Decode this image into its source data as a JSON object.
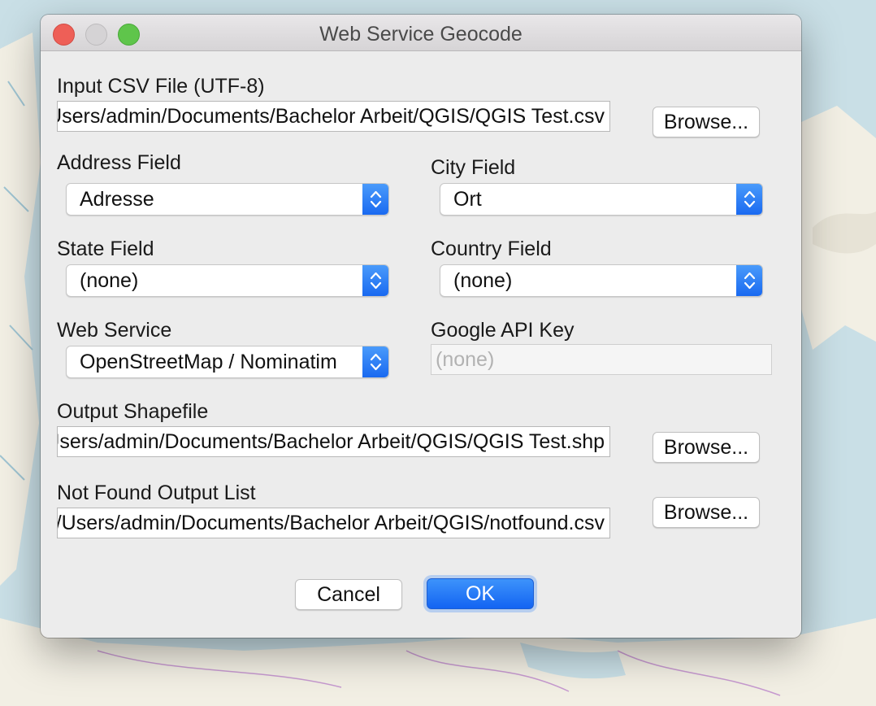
{
  "window": {
    "title": "Web Service Geocode"
  },
  "input_csv": {
    "label": "Input CSV File (UTF-8)",
    "value": "/Users/admin/Documents/Bachelor Arbeit/QGIS/QGIS Test.csv",
    "browse_label": "Browse..."
  },
  "address_field": {
    "label": "Address Field",
    "value": "Adresse"
  },
  "city_field": {
    "label": "City Field",
    "value": "Ort"
  },
  "state_field": {
    "label": "State Field",
    "value": "(none)"
  },
  "country_field": {
    "label": "Country Field",
    "value": "(none)"
  },
  "web_service": {
    "label": "Web Service",
    "value": "OpenStreetMap / Nominatim"
  },
  "google_api_key": {
    "label": "Google API Key",
    "placeholder": "(none)"
  },
  "output_shapefile": {
    "label": "Output Shapefile",
    "value": "/Users/admin/Documents/Bachelor Arbeit/QGIS/QGIS Test.shp",
    "browse_label": "Browse..."
  },
  "not_found_list": {
    "label": "Not Found Output List",
    "value": "/Users/admin/Documents/Bachelor Arbeit/QGIS/notfound.csv",
    "browse_label": "Browse..."
  },
  "buttons": {
    "cancel": "Cancel",
    "ok": "OK"
  },
  "colors": {
    "accent": "#1a6cf2",
    "close": "#ee5f57",
    "maximize": "#5fc54b",
    "map_water": "#c9dfe6",
    "map_land": "#f2efe4"
  }
}
